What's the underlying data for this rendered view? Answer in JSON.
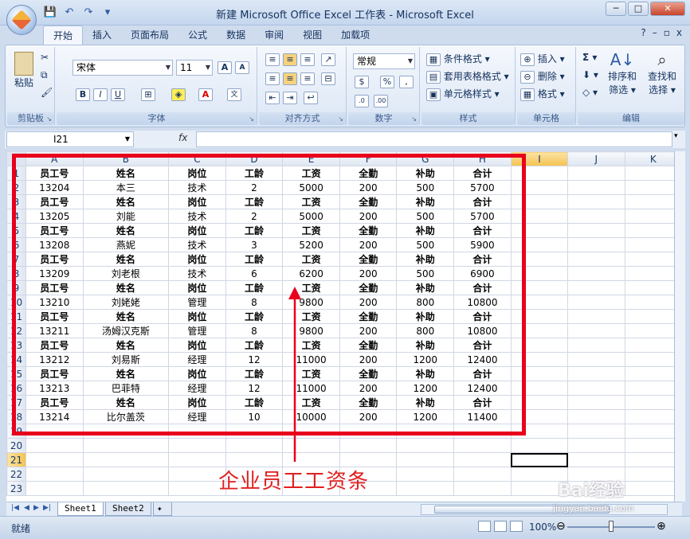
{
  "window": {
    "title": "新建 Microsoft Office Excel 工作表 - Microsoft Excel",
    "controls": {
      "minimize": "─",
      "restore": "□",
      "close": "✕"
    }
  },
  "tabs": [
    "开始",
    "插入",
    "页面布局",
    "公式",
    "数据",
    "审阅",
    "视图",
    "加载项"
  ],
  "ribbon": {
    "clipboard": {
      "label": "剪贴板",
      "paste": "粘贴"
    },
    "font": {
      "label": "字体",
      "font_name": "宋体",
      "font_size": "11"
    },
    "alignment": {
      "label": "对齐方式"
    },
    "number": {
      "label": "数字",
      "format": "常规"
    },
    "styles": {
      "label": "样式",
      "conditional": "条件格式",
      "table": "套用表格格式",
      "cell_style": "单元格样式"
    },
    "cells": {
      "label": "单元格",
      "insert": "插入",
      "delete": "删除",
      "format": "格式"
    },
    "editing": {
      "label": "编辑",
      "sort": "排序和",
      "filter": "筛选",
      "find": "查找和",
      "select": "选择"
    }
  },
  "formula_bar": {
    "name_box": "I21",
    "fx": "fx",
    "value": ""
  },
  "grid": {
    "columns": [
      "A",
      "B",
      "C",
      "D",
      "E",
      "F",
      "G",
      "H",
      "I",
      "J",
      "K"
    ],
    "header_row": [
      "员工号",
      "姓名",
      "岗位",
      "工龄",
      "工资",
      "全勤",
      "补助",
      "合计"
    ],
    "records": [
      [
        "13204",
        "本三",
        "技术",
        "2",
        "5000",
        "200",
        "500",
        "5700"
      ],
      [
        "13205",
        "刘能",
        "技术",
        "2",
        "5000",
        "200",
        "500",
        "5700"
      ],
      [
        "13208",
        "燕妮",
        "技术",
        "3",
        "5200",
        "200",
        "500",
        "5900"
      ],
      [
        "13209",
        "刘老根",
        "技术",
        "6",
        "6200",
        "200",
        "500",
        "6900"
      ],
      [
        "13210",
        "刘姥姥",
        "管理",
        "8",
        "9800",
        "200",
        "800",
        "10800"
      ],
      [
        "13211",
        "汤姆汉克斯",
        "管理",
        "8",
        "9800",
        "200",
        "800",
        "10800"
      ],
      [
        "13212",
        "刘易斯",
        "经理",
        "12",
        "11000",
        "200",
        "1200",
        "12400"
      ],
      [
        "13213",
        "巴菲特",
        "经理",
        "12",
        "11000",
        "200",
        "1200",
        "12400"
      ],
      [
        "13214",
        "比尔盖茨",
        "经理",
        "10",
        "10000",
        "200",
        "1200",
        "11400"
      ]
    ],
    "row_numbers": [
      "1",
      "2",
      "3",
      "4",
      "5",
      "6",
      "7",
      "8",
      "9",
      "10",
      "11",
      "12",
      "13",
      "14",
      "15",
      "16",
      "17",
      "18",
      "19",
      "20",
      "21",
      "22",
      "23"
    ],
    "active_cell": "I21"
  },
  "annotation": "企业员工工资条",
  "sheet_tabs": [
    "Sheet1",
    "Sheet2"
  ],
  "status": {
    "text": "就绪",
    "zoom": "100%"
  },
  "watermark": {
    "brand": "Bai经验",
    "url": "jingyan.baidu.com"
  },
  "colors": {
    "annotation": "#e8001c",
    "ribbon": "#dbe6f5"
  }
}
